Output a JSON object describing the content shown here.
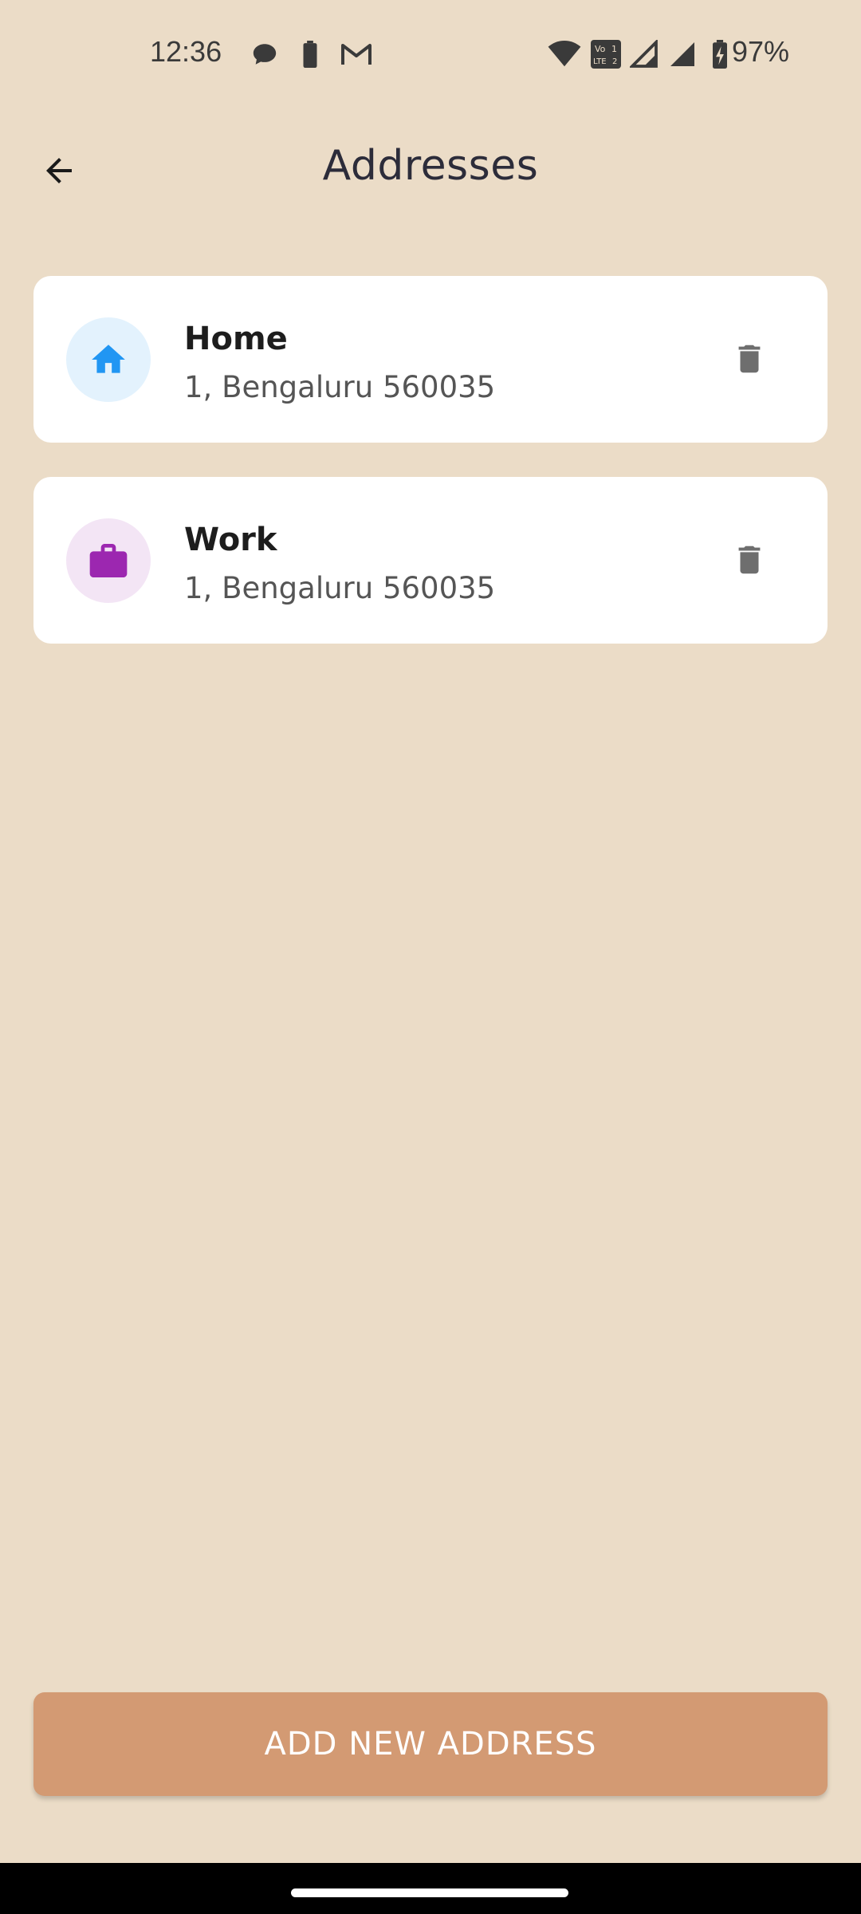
{
  "status_bar": {
    "time": "12:36",
    "battery_percent": "97%",
    "icons": [
      "chat-icon",
      "battery-saver-icon",
      "gmail-icon",
      "wifi-icon",
      "volte-icon",
      "signal-1-icon",
      "signal-2-icon",
      "battery-charging-icon"
    ]
  },
  "header": {
    "title": "Addresses",
    "back_icon": "arrow-back-icon"
  },
  "addresses": [
    {
      "label": "Home",
      "address": "1, Bengaluru 560035",
      "icon": "home-icon",
      "icon_color": "#2196f3",
      "avatar_bg": "#e3f2fd"
    },
    {
      "label": "Work",
      "address": "1, Bengaluru 560035",
      "icon": "work-icon",
      "icon_color": "#9c27b0",
      "avatar_bg": "#f3e5f5"
    }
  ],
  "actions": {
    "add_label": "ADD NEW ADDRESS",
    "delete_icon": "trash-icon"
  },
  "colors": {
    "background": "#ebdcc7",
    "card": "#ffffff",
    "button": "#d39a73",
    "button_text": "#ffffff"
  }
}
